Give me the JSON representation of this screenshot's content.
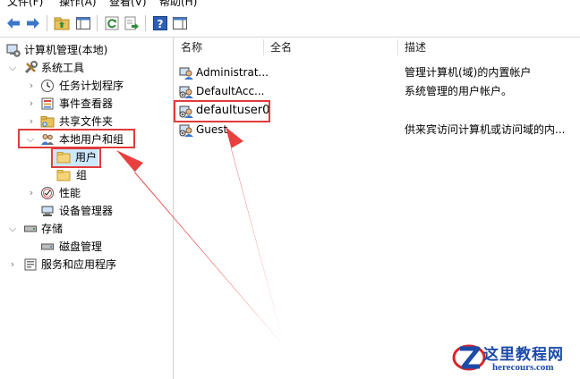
{
  "menubar": {
    "items": [
      "文件(F)",
      "操作(A)",
      "查看(V)",
      "帮助(H)"
    ]
  },
  "toolbar": {
    "buttons": [
      "back-icon",
      "forward-icon",
      "up-folder-icon",
      "show-hide-tree-icon",
      "refresh-icon",
      "export-list-icon",
      "help-icon",
      "show-hide-action-pane-icon"
    ]
  },
  "tree": {
    "root": "计算机管理(本地)",
    "system_tools": "系统工具",
    "task_scheduler": "任务计划程序",
    "event_viewer": "事件查看器",
    "shared_folders": "共享文件夹",
    "local_users_groups": "本地用户和组",
    "users": "用户",
    "groups": "组",
    "performance": "性能",
    "device_manager": "设备管理器",
    "storage": "存储",
    "disk_management": "磁盘管理",
    "services_apps": "服务和应用程序"
  },
  "list": {
    "columns": [
      "名称",
      "全名",
      "描述"
    ],
    "rows": [
      {
        "name": "Administrat...",
        "full_name": "",
        "desc": "管理计算机(域)的内置帐户"
      },
      {
        "name": "DefaultAcc...",
        "full_name": "",
        "desc": "系统管理的用户帐户。"
      },
      {
        "name": "defaultuser0",
        "full_name": "",
        "desc": ""
      },
      {
        "name": "Guest",
        "full_name": "",
        "desc": "供来宾访问计算机或访问域的内..."
      }
    ]
  },
  "watermark": {
    "title": "这里教程网",
    "url": "herecours.com"
  },
  "colors": {
    "annotation_red": "#e23b3b",
    "watermark_blue": "#1c4aa8"
  }
}
